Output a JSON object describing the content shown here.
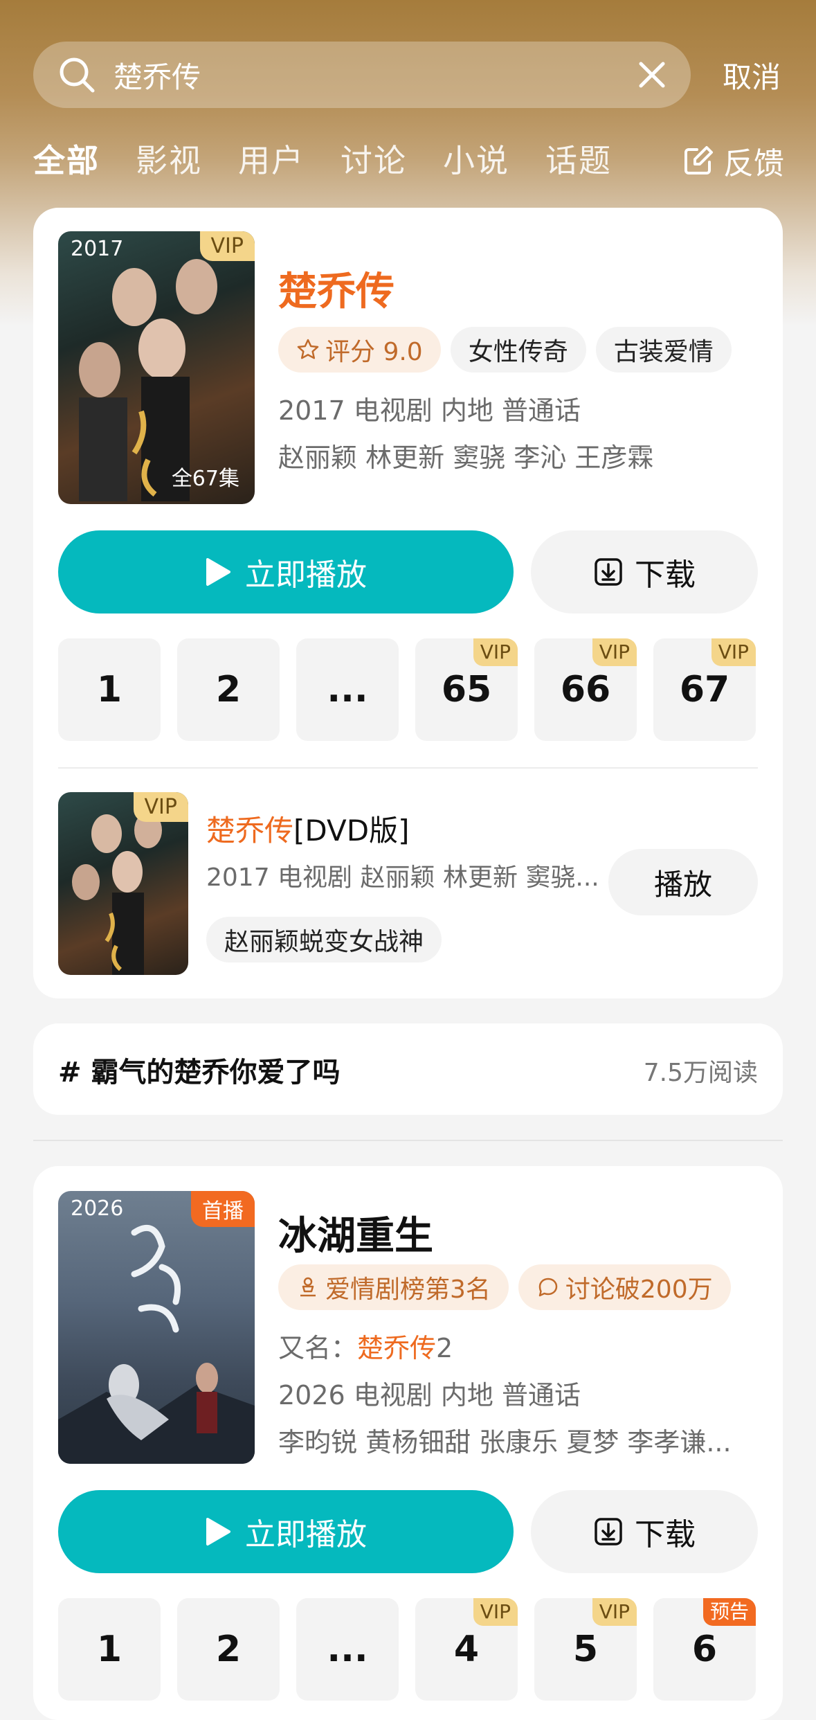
{
  "search": {
    "value": "楚乔传",
    "cancel_label": "取消"
  },
  "tabs": [
    "全部",
    "影视",
    "用户",
    "讨论",
    "小说",
    "话题"
  ],
  "feedback_label": "反馈",
  "result1": {
    "poster_year": "2017",
    "poster_badge": "VIP",
    "episode_total": "全67集",
    "title": "楚乔传",
    "rating_label": "评分 9.0",
    "tags": [
      "女性传奇",
      "古装爱情"
    ],
    "meta_line": "2017 电视剧 内地 普通话",
    "cast_line": "赵丽颖 林更新 窦骁 李沁 王彦霖",
    "play_label": "立即播放",
    "download_label": "下载",
    "episodes": [
      {
        "label": "1",
        "badge": ""
      },
      {
        "label": "2",
        "badge": ""
      },
      {
        "label": "...",
        "badge": ""
      },
      {
        "label": "65",
        "badge": "VIP"
      },
      {
        "label": "66",
        "badge": "VIP"
      },
      {
        "label": "67",
        "badge": "VIP"
      }
    ]
  },
  "result1_dvd": {
    "poster_badge": "VIP",
    "title_highlight": "楚乔传",
    "title_suffix": "[DVD版]",
    "meta_line": "2017 电视剧 赵丽颖 林更新 窦骁...",
    "tag": "赵丽颖蜕变女战神",
    "play_label": "播放"
  },
  "topic": {
    "title": "# 霸气的楚乔你爱了吗",
    "reads": "7.5万阅读"
  },
  "result2": {
    "poster_year": "2026",
    "poster_badge": "首播",
    "title": "冰湖重生",
    "chips": [
      "爱情剧榜第3名",
      "讨论破200万"
    ],
    "alias_label": "又名：",
    "alias_highlight": "楚乔传",
    "alias_suffix": "2",
    "meta_line": "2026 电视剧 内地 普通话",
    "cast_line": "李昀锐 黄杨钿甜 张康乐 夏梦 李孝谦...",
    "play_label": "立即播放",
    "download_label": "下载",
    "episodes": [
      {
        "label": "1",
        "badge": ""
      },
      {
        "label": "2",
        "badge": ""
      },
      {
        "label": "...",
        "badge": ""
      },
      {
        "label": "4",
        "badge": "VIP"
      },
      {
        "label": "5",
        "badge": "VIP"
      },
      {
        "label": "6",
        "badge": "预告"
      }
    ]
  },
  "colors": {
    "accent": "#05b9be",
    "highlight": "#ee6a1f",
    "vip_badge": "#f4d58a",
    "preview_badge": "#f26a21"
  }
}
